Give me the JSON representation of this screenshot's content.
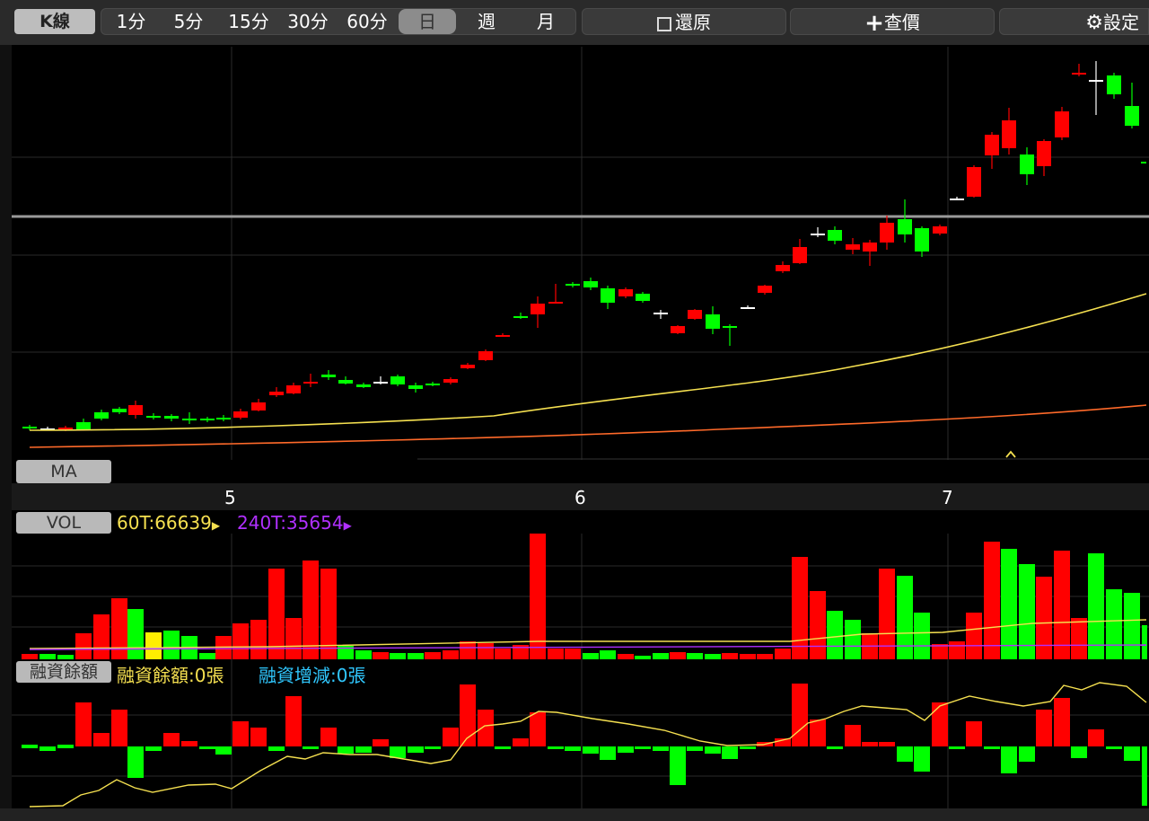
{
  "toolbar": {
    "chart_type": "K線",
    "periods": [
      {
        "label": "1分"
      },
      {
        "label": "5分"
      },
      {
        "label": "15分"
      },
      {
        "label": "30分"
      },
      {
        "label": "60分"
      },
      {
        "label": "日"
      },
      {
        "label": "週"
      },
      {
        "label": "月"
      }
    ],
    "active_period": "日",
    "restore_label": "還原",
    "lookup_label": "查價",
    "settings_label": "設定"
  },
  "price_panel": {
    "indicator_label": "MA",
    "month_labels": [
      "5",
      "6",
      "7"
    ],
    "colors": {
      "up": "#ff0000",
      "down": "#00ff00",
      "flat": "#ffffff",
      "ma_short": "#f5e050",
      "ma_long": "#ff6a2a",
      "reference_line": "#9a9a9a"
    }
  },
  "volume_panel": {
    "indicator_label": "VOL",
    "ma60_label": "60T:66639",
    "ma240_label": "240T:35654",
    "colors": {
      "ma60": "#f5e050",
      "ma240": "#b030ff"
    }
  },
  "margin_panel": {
    "indicator_label": "融資餘額",
    "balance_label": "融資餘額:0張",
    "change_label": "融資增減:0張",
    "colors": {
      "balance": "#f5e050",
      "change": "#30c8ff"
    }
  }
}
